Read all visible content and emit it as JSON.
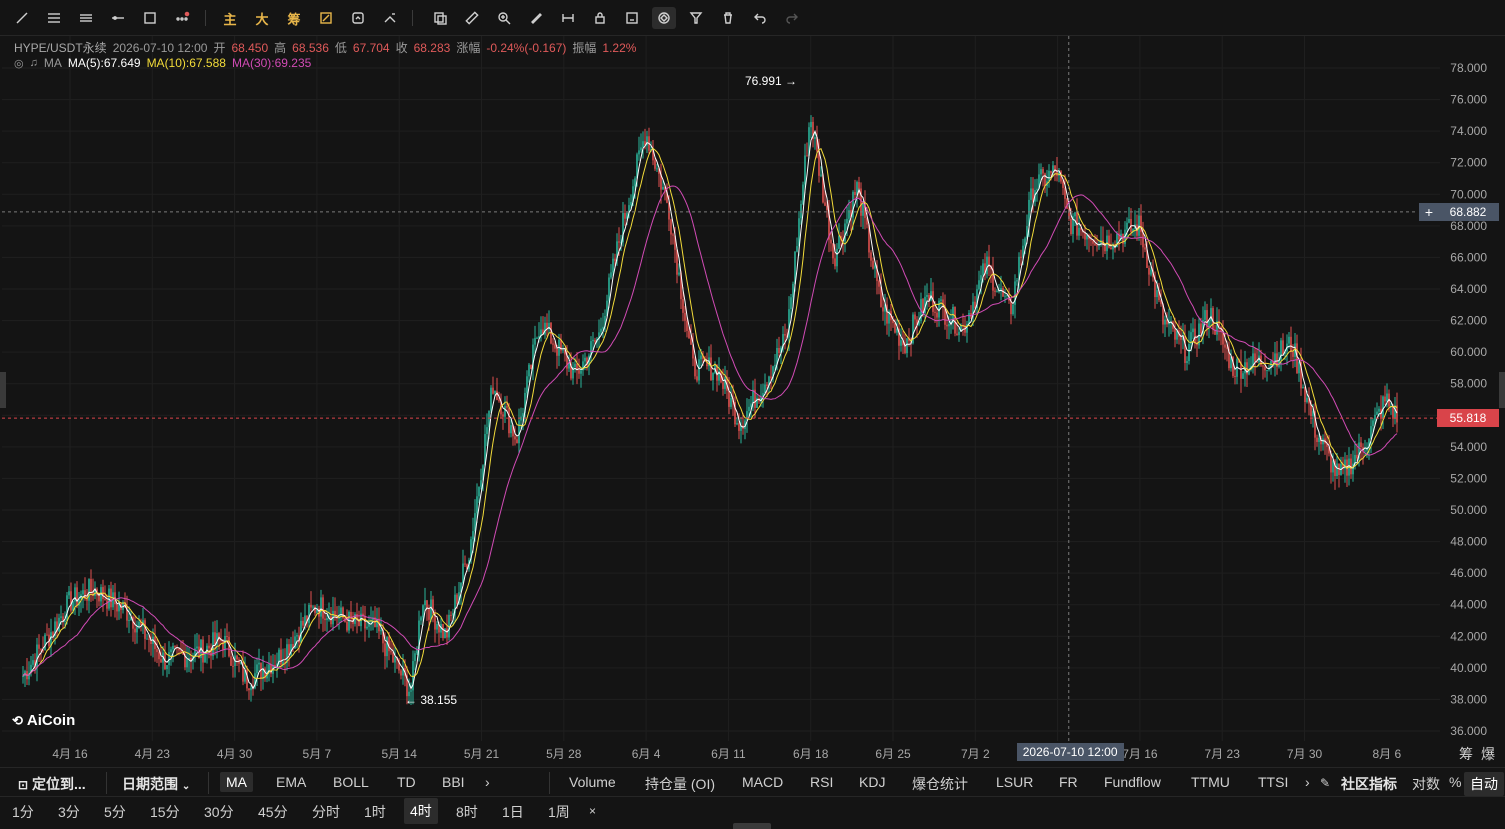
{
  "toolbar": {
    "icons": [
      "trend-line-icon",
      "horizontal-lines-icon",
      "parallel-lines-icon",
      "horizontal-ray-icon",
      "rectangle-icon",
      "more-shapes-icon",
      "brush-icon",
      "lock-icon",
      "measure-icon",
      "eraser-icon"
    ],
    "main_label": "主",
    "big_label": "大",
    "chip_label": "筹"
  },
  "info": {
    "symbol": "HYPE/USDT永续",
    "time": "2026-07-10 12:00",
    "open_label": "开",
    "open": "68.450",
    "high_label": "高",
    "high": "68.536",
    "low_label": "低",
    "low": "67.704",
    "close_label": "收",
    "close": "68.283",
    "change_label": "涨幅",
    "change": "-0.24%(-0.167)",
    "amp_label": "振幅",
    "amp": "1.22%"
  },
  "ma": {
    "name": "MA",
    "ma5": "MA(5):67.649",
    "ma10": "MA(10):67.588",
    "ma30": "MA(30):69.235",
    "colors": {
      "ma5": "#ffffff",
      "ma10": "#f3dc3a",
      "ma30": "#d14bb5"
    }
  },
  "price_axis": {
    "labels": [
      "78.000",
      "76.000",
      "74.000",
      "72.000",
      "70.000",
      "68.000",
      "66.000",
      "64.000",
      "62.000",
      "60.000",
      "58.000",
      "56.000",
      "54.000",
      "52.000",
      "50.000",
      "48.000",
      "46.000",
      "44.000",
      "42.000",
      "40.000",
      "38.000",
      "36.000"
    ],
    "crosshair_price": "68.882",
    "last_price": "55.818"
  },
  "annotations": {
    "high": "76.991 →",
    "low": "← 38.155"
  },
  "logo": "AiCoin",
  "time_axis": {
    "ticks": [
      "4月 16",
      "4月 23",
      "4月 30",
      "5月 7",
      "5月 14",
      "5月 21",
      "5月 28",
      "6月 4",
      "6月 11",
      "6月 18",
      "6月 25",
      "7月 2",
      "7月 16",
      "7月 23",
      "7月 30",
      "8月 6"
    ],
    "crosshair_time": "2026-07-10 12:00",
    "right_labels": [
      "筹",
      "爆"
    ]
  },
  "indicator_bar": {
    "locate": "定位到...",
    "date_range": "日期范围",
    "main_indicators": [
      "MA",
      "EMA",
      "BOLL",
      "TD",
      "BBI"
    ],
    "sub_indicators": [
      "Volume",
      "持仓量 (OI)",
      "MACD",
      "RSI",
      "KDJ",
      "爆仓统计",
      "LSUR",
      "FR",
      "Fundflow",
      "TTMU",
      "TTSI"
    ],
    "community": "社区指标",
    "log": "对数",
    "percent": "%",
    "auto": "自动"
  },
  "periods": [
    "1分",
    "3分",
    "5分",
    "15分",
    "30分",
    "45分",
    "分时",
    "1时",
    "4时",
    "8时",
    "1日",
    "1周"
  ],
  "active_period": "4时",
  "colors": {
    "up": "#2ab39a",
    "down": "#e0514f",
    "background": "#141414"
  },
  "chart_data": {
    "type": "candlestick",
    "symbol": "HYPE/USDT永续",
    "interval": "4h",
    "ylim": [
      36,
      78
    ],
    "x_ticks": [
      "4月 16",
      "4月 23",
      "4月 30",
      "5月 7",
      "5月 14",
      "5月 21",
      "5月 28",
      "6月 4",
      "6月 11",
      "6月 18",
      "6月 25",
      "7月 2",
      "7月 16",
      "7月 23",
      "7月 30",
      "8月 6"
    ],
    "close_path": [
      [
        "04-12",
        39.5
      ],
      [
        "04-14",
        41.8
      ],
      [
        "04-16",
        44.2
      ],
      [
        "04-18",
        45.0
      ],
      [
        "04-21",
        43.5
      ],
      [
        "04-24",
        40.5
      ],
      [
        "04-27",
        41.0
      ],
      [
        "04-29",
        41.8
      ],
      [
        "05-01",
        39.2
      ],
      [
        "05-04",
        40.8
      ],
      [
        "05-07",
        44.0
      ],
      [
        "05-10",
        42.8
      ],
      [
        "05-12",
        42.5
      ],
      [
        "05-15",
        38.5
      ],
      [
        "05-16",
        44.5
      ],
      [
        "05-18",
        42.0
      ],
      [
        "05-20",
        47.5
      ],
      [
        "05-22",
        58.0
      ],
      [
        "05-24",
        54.5
      ],
      [
        "05-26",
        62.0
      ],
      [
        "05-29",
        58.5
      ],
      [
        "05-31",
        61.0
      ],
      [
        "06-02",
        68.0
      ],
      [
        "06-04",
        74.0
      ],
      [
        "06-06",
        69.0
      ],
      [
        "06-08",
        59.0
      ],
      [
        "06-10",
        59.0
      ],
      [
        "06-12",
        55.5
      ],
      [
        "06-14",
        58.0
      ],
      [
        "06-16",
        61.0
      ],
      [
        "06-18",
        75.0
      ],
      [
        "06-20",
        66.0
      ],
      [
        "06-22",
        70.5
      ],
      [
        "06-24",
        63.0
      ],
      [
        "06-26",
        60.5
      ],
      [
        "06-28",
        63.5
      ],
      [
        "07-01",
        61.5
      ],
      [
        "07-03",
        65.5
      ],
      [
        "07-05",
        62.5
      ],
      [
        "07-07",
        70.5
      ],
      [
        "07-09",
        71.5
      ],
      [
        "07-10",
        68.3
      ],
      [
        "07-13",
        67.0
      ],
      [
        "07-16",
        68.0
      ],
      [
        "07-18",
        62.0
      ],
      [
        "07-20",
        60.0
      ],
      [
        "07-22",
        62.5
      ],
      [
        "07-24",
        59.0
      ],
      [
        "07-27",
        59.5
      ],
      [
        "07-29",
        60.5
      ],
      [
        "07-31",
        55.0
      ],
      [
        "08-02",
        52.0
      ],
      [
        "08-04",
        54.0
      ],
      [
        "08-06",
        57.0
      ],
      [
        "08-07",
        55.8
      ]
    ],
    "annotations": {
      "high": 76.991,
      "low": 38.155,
      "last": 55.818,
      "crosshair_price": 68.882,
      "crosshair_time": "2026-07-10 12:00"
    }
  }
}
